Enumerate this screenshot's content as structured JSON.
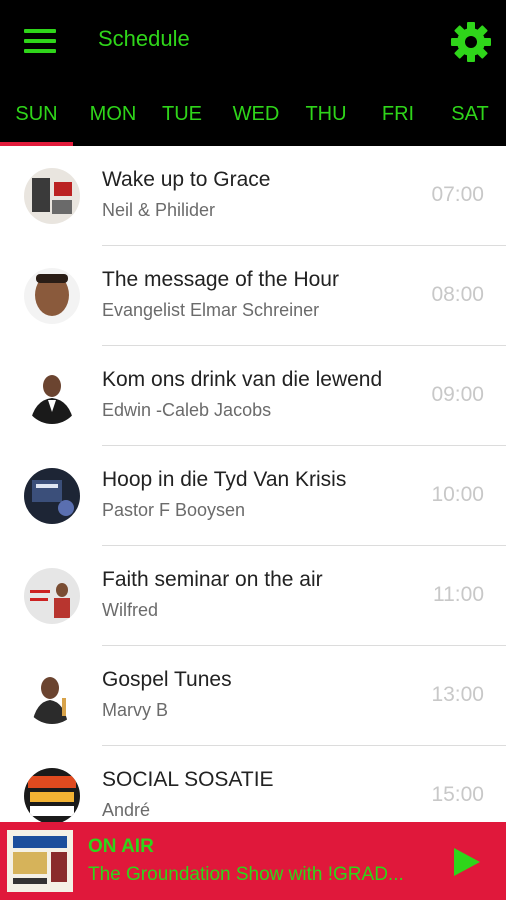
{
  "header": {
    "title": "Schedule",
    "menu_icon": "hamburger-menu-icon",
    "settings_icon": "gear-icon"
  },
  "colors": {
    "accent": "#2fd51a",
    "bar_background": "#000000",
    "player_background": "#e0183b",
    "active_indicator": "#e21b3b"
  },
  "days": [
    "SUN",
    "MON",
    "TUE",
    "WED",
    "THU",
    "FRI",
    "SAT"
  ],
  "active_day": "SUN",
  "schedule": [
    {
      "title": "Wake up to Grace",
      "host": "Neil & Philider",
      "time": "07:00"
    },
    {
      "title": "The message of the Hour",
      "host": "Evangelist Elmar Schreiner",
      "time": "08:00"
    },
    {
      "title": "Kom ons drink van die lewend",
      "host": "Edwin -Caleb Jacobs",
      "time": "09:00"
    },
    {
      "title": "Hoop in die Tyd Van Krisis",
      "host": "Pastor F Booysen",
      "time": "10:00"
    },
    {
      "title": "Faith seminar on the air",
      "host": "Wilfred",
      "time": "11:00"
    },
    {
      "title": "Gospel Tunes",
      "host": "Marvy B",
      "time": "13:00"
    },
    {
      "title": "SOCIAL SOSATIE",
      "host": "André",
      "time": "15:00"
    }
  ],
  "player": {
    "status": "ON AIR",
    "now_playing": "The Groundation Show with !GRAD...",
    "play_icon": "play-icon"
  }
}
